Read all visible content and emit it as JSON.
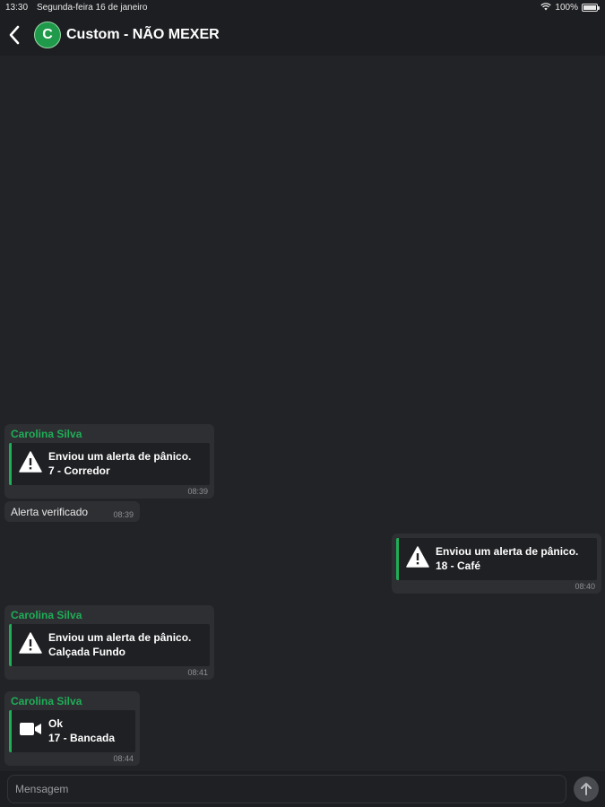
{
  "status_bar": {
    "time": "13:30",
    "date": "Segunda-feira 16 de janeiro",
    "battery": "100%",
    "icons": [
      "wifi-icon",
      "battery-icon"
    ]
  },
  "header": {
    "avatar_letter": "C",
    "title": "Custom - NÃO MEXER",
    "accent_color": "#1e9a4a"
  },
  "messages": [
    {
      "sender": "Carolina Silva",
      "icon": "alert-triangle-icon",
      "line1": "Enviou um alerta de pânico.",
      "line2": "7 - Corredor",
      "time": "08:39"
    },
    {
      "text": "Alerta verificado",
      "time": "08:39"
    },
    {
      "icon": "alert-triangle-icon",
      "line1": "Enviou um alerta de pânico.",
      "line2": "18 - Café",
      "time": "08:40"
    },
    {
      "sender": "Carolina Silva",
      "icon": "alert-triangle-icon",
      "line1": "Enviou um alerta de pânico.",
      "line2": "Calçada Fundo",
      "time": "08:41"
    },
    {
      "sender": "Carolina Silva",
      "icon": "video-camera-icon",
      "line1": "Ok",
      "line2": "17 - Bancada",
      "time": "08:44"
    }
  ],
  "composer": {
    "placeholder": "Mensagem",
    "send_icon": "arrow-up-icon"
  },
  "colors": {
    "background": "#222326",
    "bubble": "#2e2f33",
    "sender_name": "#1fae57"
  }
}
